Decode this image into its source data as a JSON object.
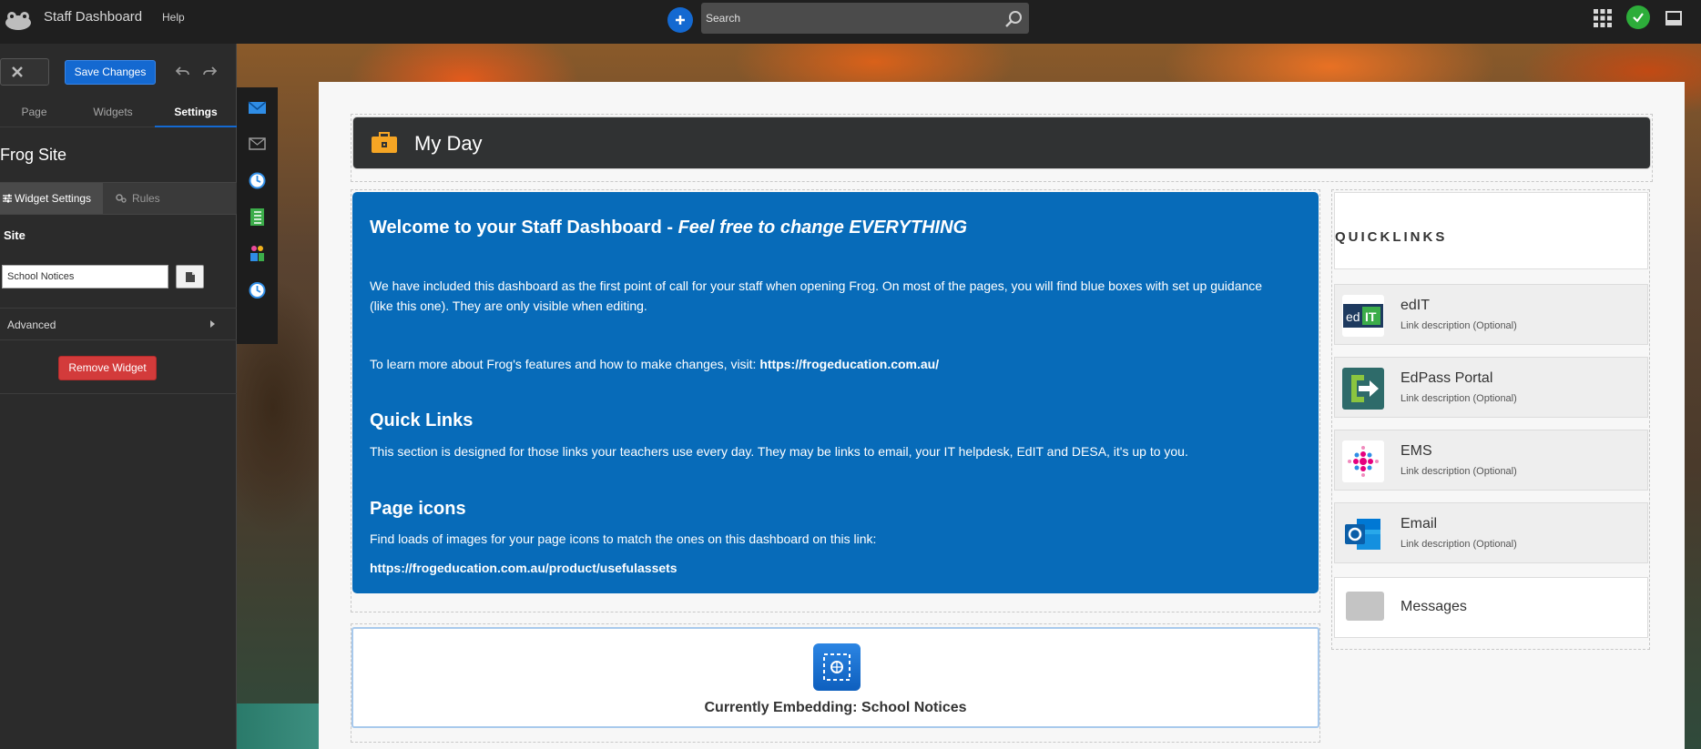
{
  "topbar": {
    "app_title": "Staff Dashboard",
    "help_label": "Help",
    "search_placeholder": "Search"
  },
  "sidebar": {
    "save_label": "Save Changes",
    "tabs": [
      {
        "label": "Page"
      },
      {
        "label": "Widgets"
      },
      {
        "label": "Settings"
      }
    ],
    "site_title": "Frog Site",
    "subtabs": [
      {
        "label": "Widget Settings"
      },
      {
        "label": "Rules"
      }
    ],
    "site_label": "Site",
    "site_value": "School Notices",
    "advanced_label": "Advanced",
    "remove_label": "Remove Widget"
  },
  "main": {
    "my_day_title": "My Day",
    "welcome": {
      "title_plain": "Welcome to your Staff Dashboard - ",
      "title_emphasis": "Feel free to change EVERYTHING",
      "p1": "We have included this dashboard as the first point of call for your staff when opening Frog.  On most of the pages, you will find blue boxes with set up guidance (like this one).  They are only visible when editing.",
      "p2_text": "To learn more about Frog's features and how to make changes, visit: ",
      "p2_link": "https://frogeducation.com.au/",
      "quick_links_heading": "Quick Links",
      "p3": "This section is designed for those links your teachers use every day.  They may be links to email, your IT helpdesk, EdIT and DESA, it's up to you.",
      "page_icons_heading": "Page icons",
      "p4": "Find loads of images for your page icons to match the ones on this dashboard on this link:",
      "p5": "https://frogeducation.com.au/product/usefulassets"
    },
    "embed_label": "Currently Embedding: School Notices"
  },
  "quicklinks": {
    "title": "QUICKLINKS",
    "items": [
      {
        "name": "edIT",
        "desc": "Link description (Optional)"
      },
      {
        "name": "EdPass Portal",
        "desc": "Link description (Optional)"
      },
      {
        "name": "EMS",
        "desc": "Link description (Optional)"
      },
      {
        "name": "Email",
        "desc": "Link description (Optional)"
      }
    ],
    "messages_label": "Messages"
  },
  "colors": {
    "accent_blue": "#1469d1",
    "welcome_blue": "#076bb9",
    "remove_red": "#d33b3b",
    "status_green": "#2dad3a"
  }
}
